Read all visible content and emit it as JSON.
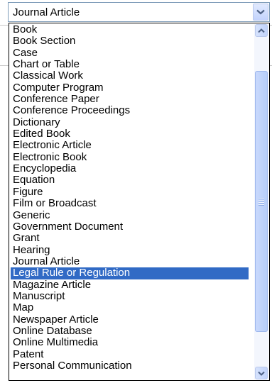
{
  "combo": {
    "selected_label": "Journal Article",
    "dropdown_icon": "chevron-down-icon"
  },
  "list": {
    "options": [
      "Book",
      "Book Section",
      "Case",
      "Chart or Table",
      "Classical Work",
      "Computer Program",
      "Conference Paper",
      "Conference Proceedings",
      "Dictionary",
      "Edited Book",
      "Electronic Article",
      "Electronic Book",
      "Encyclopedia",
      "Equation",
      "Figure",
      "Film or Broadcast",
      "Generic",
      "Government Document",
      "Grant",
      "Hearing",
      "Journal Article",
      "Legal Rule or Regulation",
      "Magazine Article",
      "Manuscript",
      "Map",
      "Newspaper Article",
      "Online Database",
      "Online Multimedia",
      "Patent",
      "Personal Communication"
    ],
    "highlighted_option": "Legal Rule or Regulation"
  },
  "scrollbar": {
    "up_icon": "chevron-up-icon",
    "down_icon": "chevron-down-icon",
    "grip_icon": "grip-icon"
  },
  "colors": {
    "highlight": "#316ac5",
    "border": "#7f9db9",
    "scroll_track": "#f3f6fd"
  }
}
